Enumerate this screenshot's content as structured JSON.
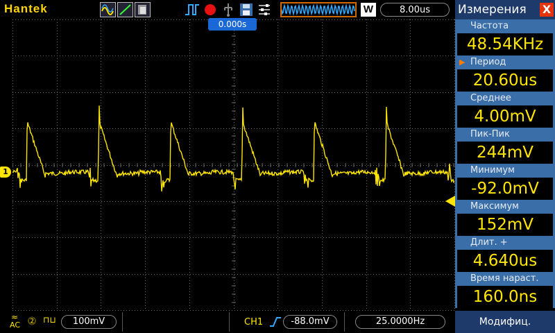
{
  "brand": "Hantek",
  "timebase": "8.00us",
  "trigger_position": "0.000s",
  "wave_button": "W",
  "ch1_marker": "1",
  "sidebar": {
    "title": "Измерения",
    "close": "X",
    "measurements": [
      {
        "label": "Частота",
        "value": "48.54KHz",
        "active": false
      },
      {
        "label": "Период",
        "value": "20.60us",
        "active": true
      },
      {
        "label": "Среднее",
        "value": "4.00mV",
        "active": false
      },
      {
        "label": "Пик-Пик",
        "value": "244mV",
        "active": false
      },
      {
        "label": "Минимум",
        "value": "-92.0mV",
        "active": false
      },
      {
        "label": "Максимум",
        "value": "152mV",
        "active": false
      },
      {
        "label": "Длит. +",
        "value": "4.640us",
        "active": false
      },
      {
        "label": "Время нараст.",
        "value": "160.0ns",
        "active": false
      }
    ],
    "modify_button": "Модифиц."
  },
  "bottombar": {
    "coupling": "AC",
    "scale": "100mV",
    "channel": "CH1",
    "trigger_level": "-88.0mV",
    "frequency": "25.0000Hz"
  },
  "colors": {
    "trace": "#ffe600",
    "grid": "#6a6a6a",
    "accent": "#3a6ea8",
    "title_bg": "#1e3a6a"
  }
}
